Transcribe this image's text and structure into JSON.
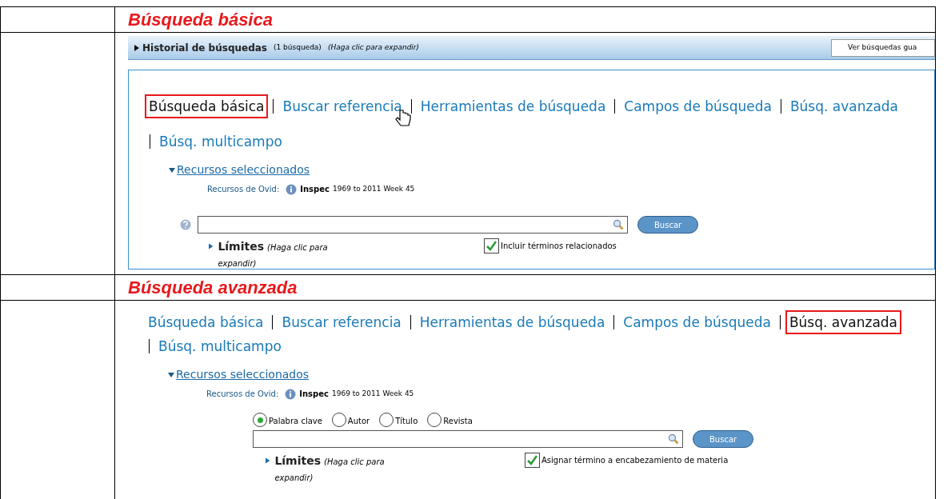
{
  "sections": [
    {
      "heading": "Búsqueda básica",
      "history": {
        "label": "Historial de búsquedas",
        "count": "(1 búsqueda)",
        "hint": "(Haga clic para expandir)",
        "button": "Ver búsquedas gua"
      },
      "tabs": [
        {
          "label": "Búsqueda básica",
          "selected": true,
          "highlighted": true
        },
        {
          "label": "Buscar referencia",
          "selected": false,
          "highlighted": false
        },
        {
          "label": "Herramientas de búsqueda",
          "selected": false,
          "highlighted": false
        },
        {
          "label": "Campos de búsqueda",
          "selected": false,
          "highlighted": false
        },
        {
          "label": "Búsq. avanzada",
          "selected": false,
          "highlighted": false
        },
        {
          "label": "Búsq. multicampo",
          "selected": false,
          "highlighted": false
        }
      ],
      "resources_link": "Recursos seleccionados",
      "resources_label": "Recursos de Ovid:",
      "resource_name": "Inspec",
      "resource_range": "1969 to 2011 Week 45",
      "search_button": "Buscar",
      "limits_label": "Límites",
      "limits_hint": "(Haga clic para expandir)",
      "checkbox": {
        "label": "Incluir términos relacionados",
        "checked": true
      }
    },
    {
      "heading": "Búsqueda avanzada",
      "tabs": [
        {
          "label": "Búsqueda básica",
          "selected": false,
          "highlighted": false
        },
        {
          "label": "Buscar referencia",
          "selected": false,
          "highlighted": false
        },
        {
          "label": "Herramientas de búsqueda",
          "selected": false,
          "highlighted": false
        },
        {
          "label": "Campos de búsqueda",
          "selected": false,
          "highlighted": false
        },
        {
          "label": "Búsq. avanzada",
          "selected": true,
          "highlighted": true
        },
        {
          "label": "Búsq. multicampo",
          "selected": false,
          "highlighted": false
        }
      ],
      "resources_link": "Recursos seleccionados",
      "resources_label": "Recursos de Ovid:",
      "resource_name": "Inspec",
      "resource_range": "1969 to 2011 Week 45",
      "radios": [
        {
          "label": "Palabra clave",
          "selected": true
        },
        {
          "label": "Autor",
          "selected": false
        },
        {
          "label": "Título",
          "selected": false
        },
        {
          "label": "Revista",
          "selected": false
        }
      ],
      "search_button": "Buscar",
      "limits_label": "Límites",
      "limits_hint": "(Haga clic para expandir)",
      "checkbox": {
        "label": "Asignar término a encabezamiento de materia",
        "checked": true
      }
    }
  ]
}
